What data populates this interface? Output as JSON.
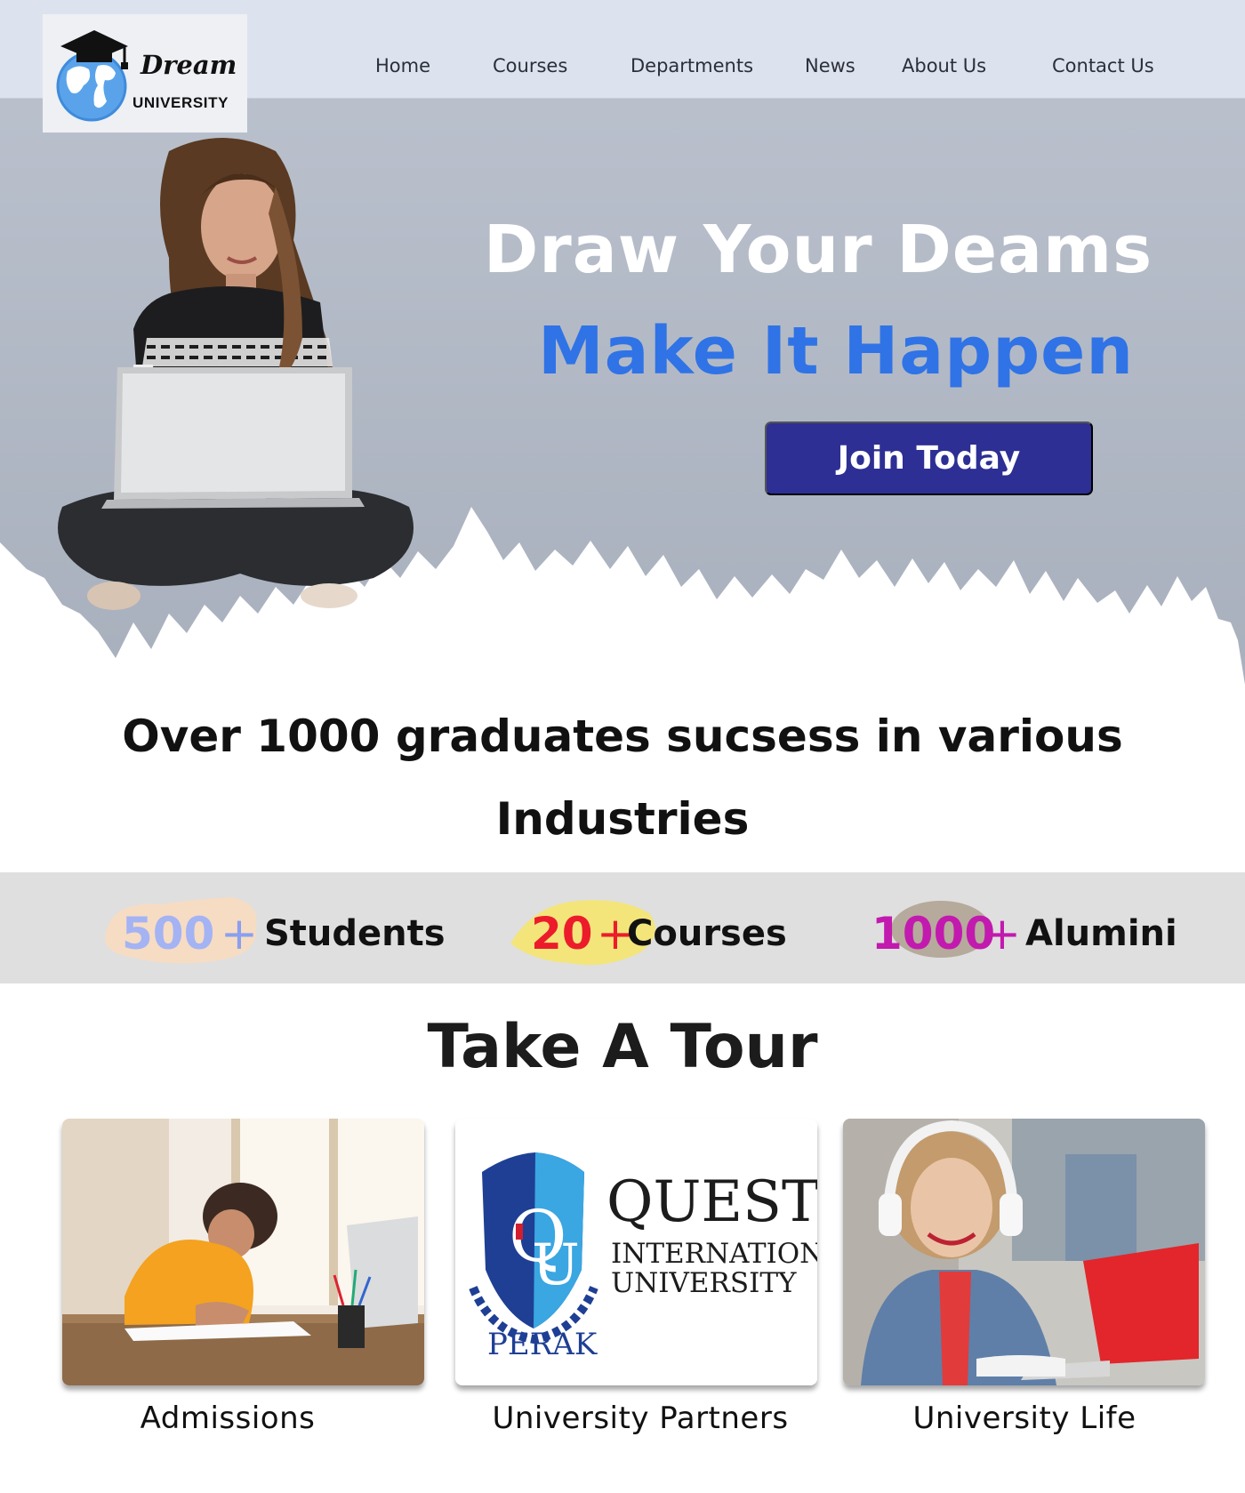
{
  "brand": {
    "name_script": "Dream",
    "name_caps": "UNIVERSITY"
  },
  "nav": {
    "items": [
      "Home",
      "Courses",
      "Departments",
      "News",
      "About Us",
      "Contact Us"
    ]
  },
  "hero": {
    "headline_1": "Draw Your Deams",
    "headline_2": "Make It Happen",
    "cta_label": "Join Today"
  },
  "graduates": {
    "line_1": "Over 1000 graduates sucsess in various",
    "line_2": "Industries"
  },
  "stats": [
    {
      "number": "500",
      "plus": "+",
      "label": "Students",
      "number_color": "#a3b3f4",
      "plus_color": "#8aa0ee",
      "blob_color": "#f6dcc3"
    },
    {
      "number": "20",
      "plus": "+",
      "label": "Courses",
      "number_color": "#ec1c2b",
      "plus_color": "#ec1c2b",
      "blob_color": "#f3e57a"
    },
    {
      "number": "1000",
      "plus": "+",
      "label": "Alumini",
      "number_color": "#c21aae",
      "plus_color": "#c21aae",
      "blob_color": "#b6aa9c"
    }
  ],
  "tour": {
    "title": "Take A Tour",
    "cards": [
      {
        "label": "Admissions",
        "image": "student-writing-photo"
      },
      {
        "label": "University Partners",
        "image": "quest-university-logo",
        "logo_text": {
          "line_1": "QUEST",
          "line_2": "INTERNATIONAL",
          "line_3": "UNIVERSITY",
          "place": "PERAK"
        }
      },
      {
        "label": "University Life",
        "image": "student-headphones-photo"
      }
    ]
  },
  "colors": {
    "nav_bg": "#dde3ee",
    "accent_blue": "#2f73e6",
    "cta_bg": "#2d2f94",
    "stats_bg": "#dfdfdf"
  }
}
